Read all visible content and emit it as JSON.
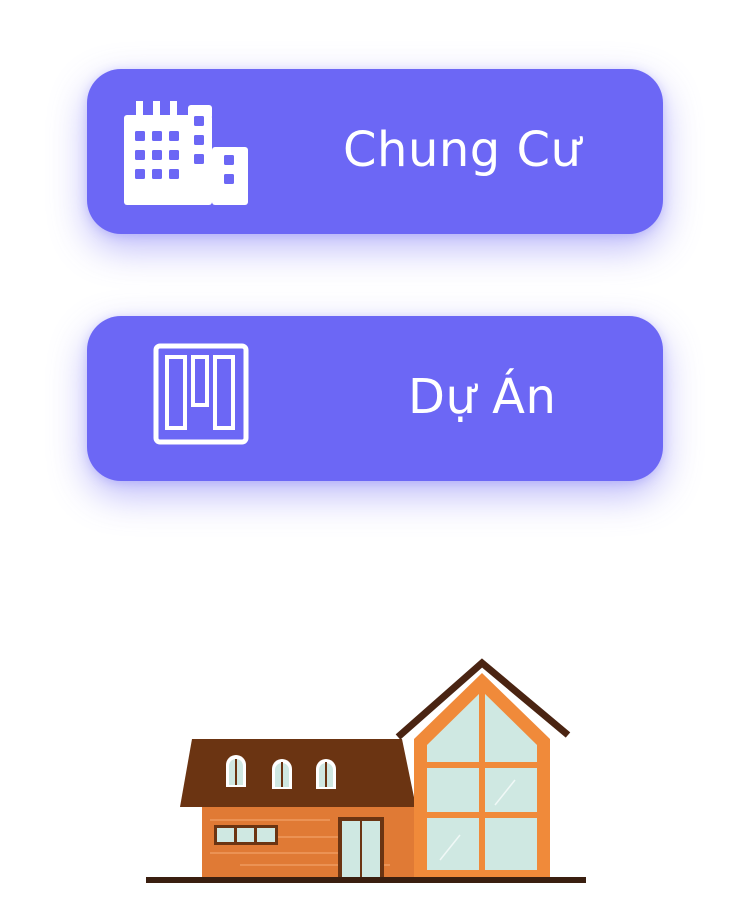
{
  "menu": {
    "items": [
      {
        "label": "Chung Cư",
        "icon": "apartment-building-icon"
      },
      {
        "label": "Dự Án",
        "icon": "project-board-icon"
      }
    ]
  },
  "illustration": {
    "icon": "house-illustration"
  },
  "colors": {
    "button_background": "#6c67f5",
    "button_text": "#ffffff",
    "roof_brown": "#6b3412",
    "wall_orange": "#e07a35",
    "frame_orange": "#f08a3a",
    "glass": "#cfe8e2",
    "ground": "#3a1f10"
  }
}
